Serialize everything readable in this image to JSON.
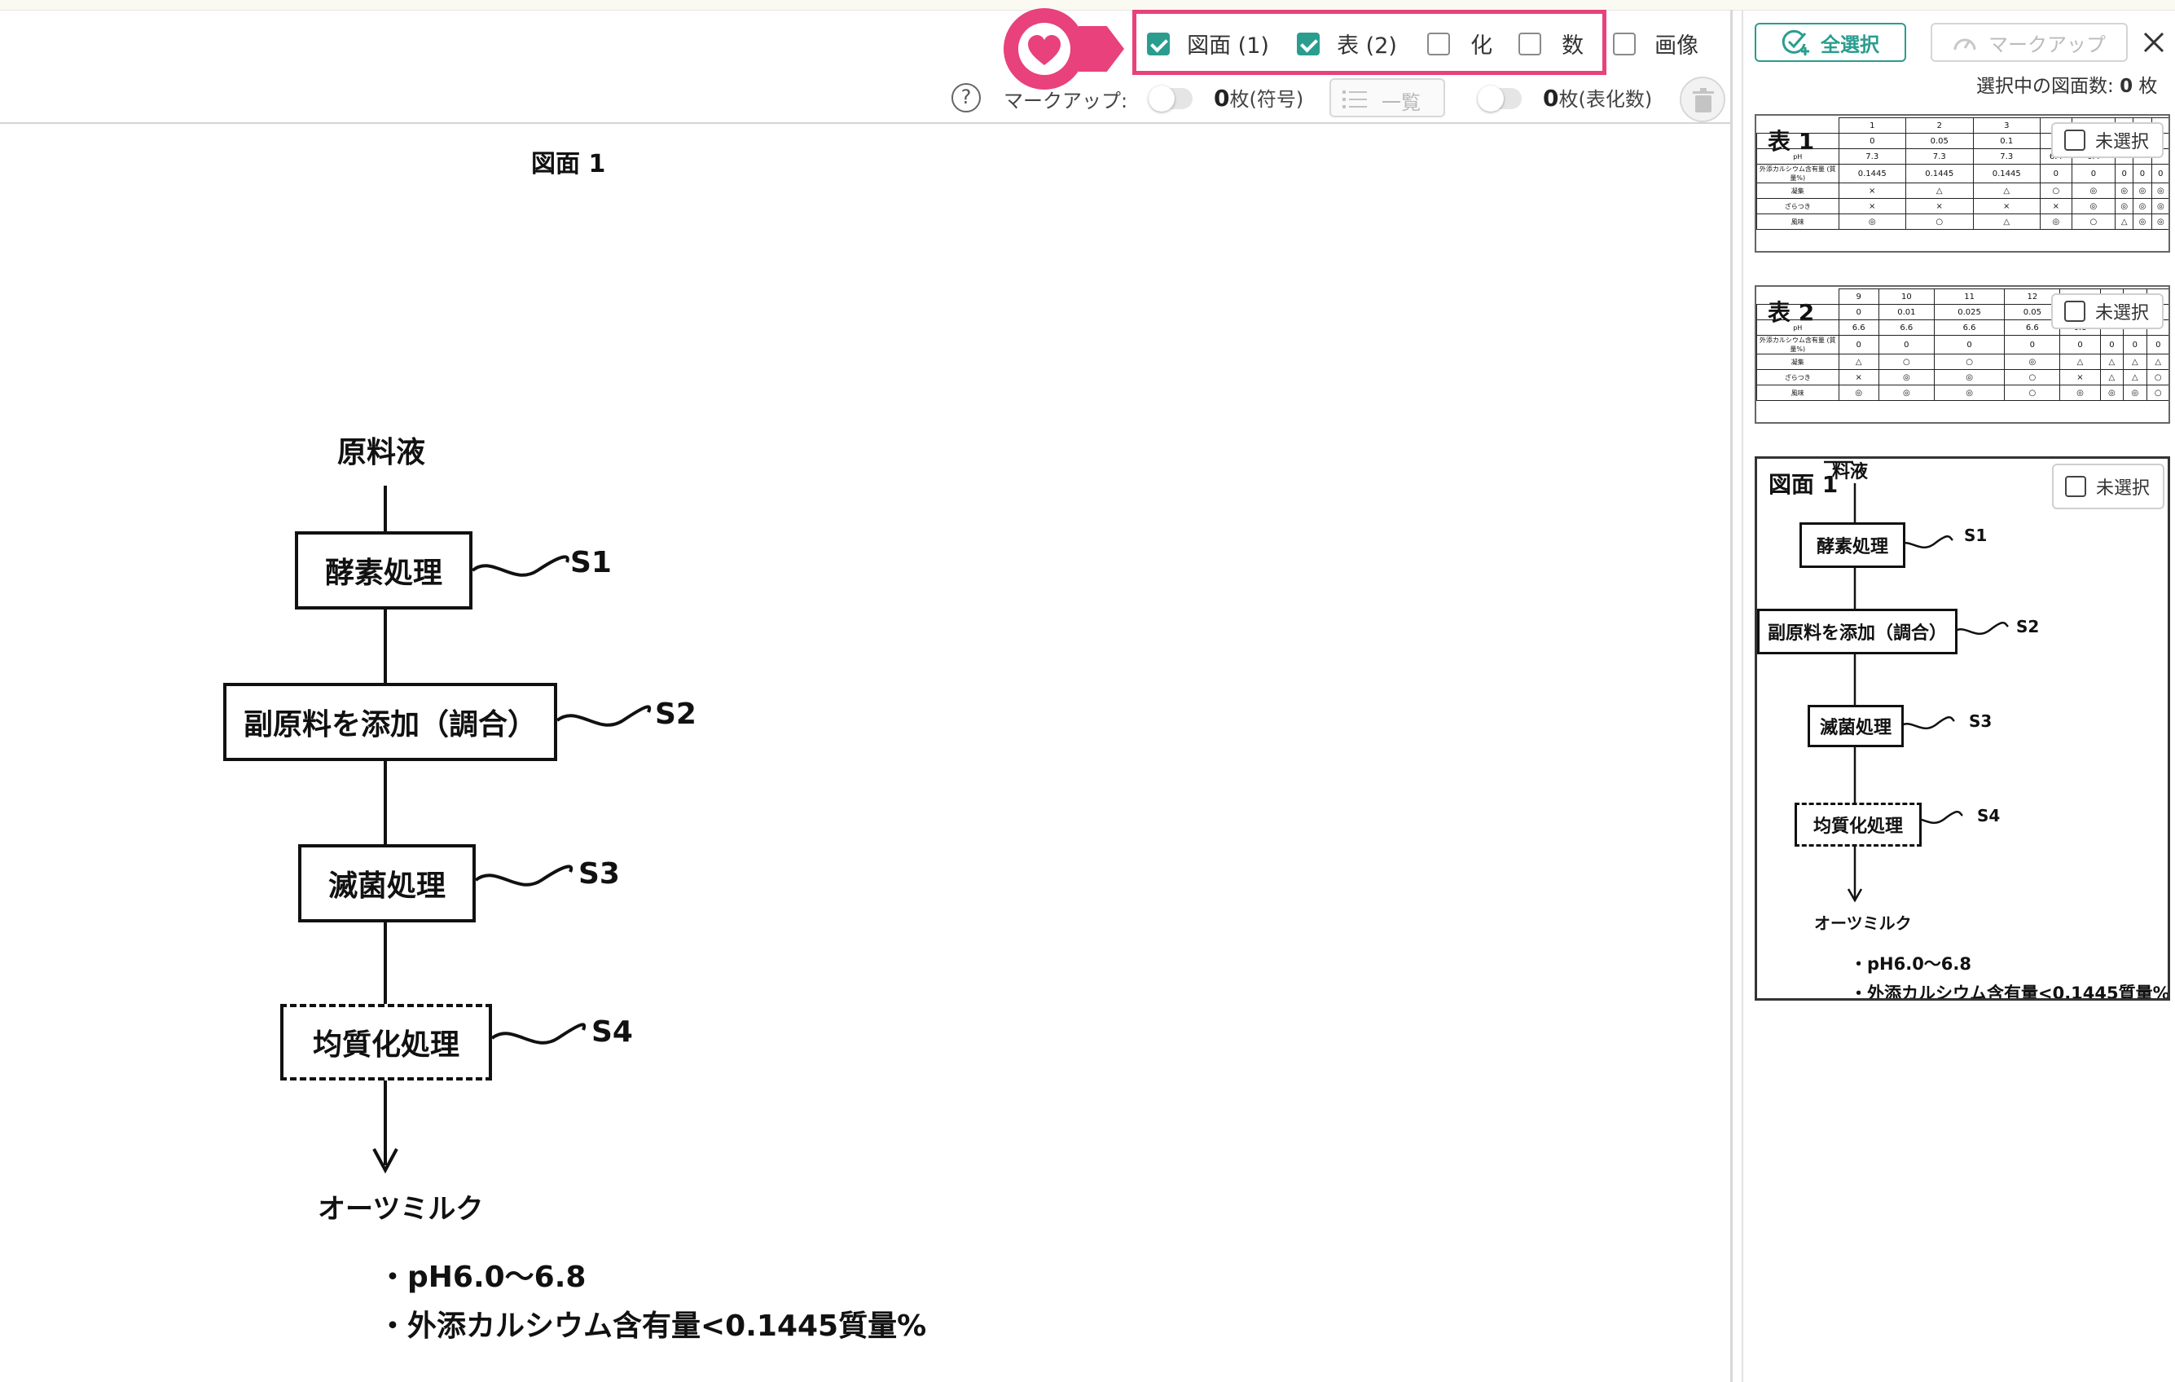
{
  "header": {
    "filters": [
      {
        "label": "図面 (1)",
        "checked": true
      },
      {
        "label": "表 (2)",
        "checked": true
      },
      {
        "label": "化",
        "checked": false
      },
      {
        "label": "数",
        "checked": false
      },
      {
        "label": "画像",
        "checked": false
      }
    ],
    "markup_label": "マークアップ:",
    "count_symbol": "0",
    "count_symbol_unit": "枚(符号)",
    "list_button": "一覧",
    "count_table": "0",
    "count_table_unit": "枚(表化数)",
    "accent_color": "#e8417c",
    "check_color": "#2a9d8f"
  },
  "figure": {
    "title": "図面 1",
    "start": "原料液",
    "steps": [
      {
        "label": "酵素処理",
        "tag": "S1"
      },
      {
        "label": "副原料を添加（調合）",
        "tag": "S2"
      },
      {
        "label": "滅菌処理",
        "tag": "S3"
      },
      {
        "label": "均質化処理",
        "tag": "S4"
      }
    ],
    "end": "オーツミルク",
    "notes": [
      "・pH6.0～6.8",
      "・外添カルシウム含有量<0.1445質量%"
    ]
  },
  "sidebar": {
    "select_all": "全選択",
    "markup": "マークアップ",
    "selected_count_label": "選択中の図面数:",
    "selected_count": "0",
    "selected_unit": "枚",
    "unselected_label": "未選択",
    "cards": [
      {
        "title": "表 1",
        "header": [
          "1",
          "2",
          "3",
          "4",
          "5"
        ],
        "rows": [
          {
            "label": "",
            "cells": [
              "0",
              "0.05",
              "0.1",
              "0",
              "0.05",
              "",
              "",
              ""
            ]
          },
          {
            "label": "pH",
            "cells": [
              "7.3",
              "7.3",
              "7.3",
              "6.4",
              "6.4",
              "",
              "",
              ""
            ]
          },
          {
            "label": "外添カルシウム含有量 (質量%)",
            "cells": [
              "0.1445",
              "0.1445",
              "0.1445",
              "0",
              "0",
              "0",
              "0",
              "0"
            ]
          },
          {
            "label": "凝集",
            "cells": [
              "×",
              "△",
              "△",
              "○",
              "◎",
              "◎",
              "◎",
              "◎"
            ]
          },
          {
            "label": "ざらつき",
            "cells": [
              "×",
              "×",
              "×",
              "×",
              "◎",
              "◎",
              "◎",
              "◎"
            ]
          },
          {
            "label": "風味",
            "cells": [
              "◎",
              "○",
              "△",
              "◎",
              "○",
              "△",
              "◎",
              "◎"
            ]
          }
        ]
      },
      {
        "title": "表 2",
        "header": [
          "9",
          "10",
          "11",
          "12",
          "13"
        ],
        "rows": [
          {
            "label": "",
            "cells": [
              "0",
              "0.01",
              "0.025",
              "0.05",
              "0",
              "",
              "",
              ""
            ]
          },
          {
            "label": "pH",
            "cells": [
              "6.6",
              "6.6",
              "6.6",
              "6.6",
              "6.8",
              "",
              "",
              ""
            ]
          },
          {
            "label": "外添カルシウム含有量 (質量%)",
            "cells": [
              "0",
              "0",
              "0",
              "0",
              "0",
              "0",
              "0",
              "0"
            ]
          },
          {
            "label": "凝集",
            "cells": [
              "△",
              "○",
              "○",
              "◎",
              "△",
              "△",
              "△",
              "△"
            ]
          },
          {
            "label": "ざらつき",
            "cells": [
              "×",
              "◎",
              "◎",
              "○",
              "×",
              "△",
              "△",
              "○"
            ]
          },
          {
            "label": "風味",
            "cells": [
              "◎",
              "◎",
              "◎",
              "○",
              "◎",
              "◎",
              "◎",
              "○"
            ]
          }
        ]
      }
    ],
    "figure_card": {
      "title": "図面 1",
      "start": "料液"
    }
  }
}
